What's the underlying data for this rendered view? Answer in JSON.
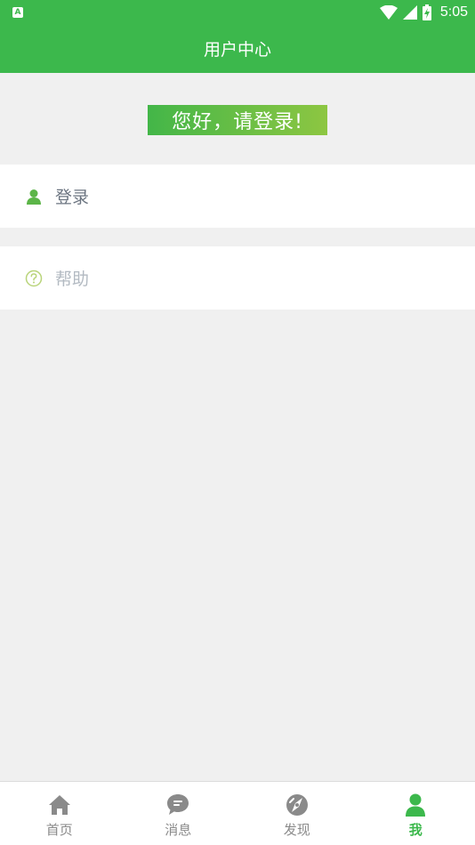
{
  "status_bar": {
    "notification_icon": "A",
    "icons": [
      "wifi-icon",
      "cell-signal-icon",
      "battery-charging-icon"
    ],
    "time": "5:05"
  },
  "app_bar": {
    "title": "用户中心"
  },
  "greeting": {
    "text": "您好，请登录!"
  },
  "menu": {
    "login": {
      "label": "登录",
      "icon": "user-icon"
    },
    "help": {
      "label": "帮助",
      "icon": "help-circle-icon"
    }
  },
  "bottom_nav": {
    "items": [
      {
        "label": "首页",
        "icon": "home-icon"
      },
      {
        "label": "消息",
        "icon": "message-icon"
      },
      {
        "label": "发现",
        "icon": "discover-icon"
      },
      {
        "label": "我",
        "icon": "user-icon"
      }
    ],
    "active_index": 3
  },
  "colors": {
    "primary": "#3cb84c",
    "greeting_gradient_end": "#8dc642",
    "background": "#f0f0f0",
    "inactive_nav": "#8a8a8a"
  }
}
